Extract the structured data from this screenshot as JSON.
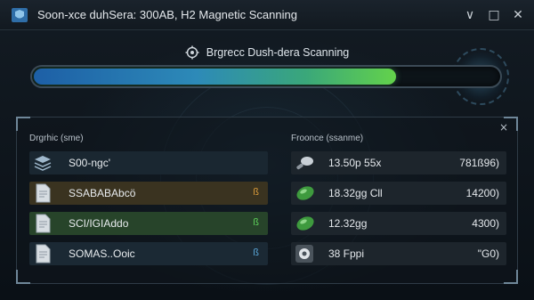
{
  "window": {
    "title": "Soon-xce duhSera: 300AB, H2 Magnetic Scanning",
    "minimize_glyph": "∨",
    "restore_glyph": "□",
    "close_glyph": "✕"
  },
  "scan": {
    "title": "Brgrecc Dush-dera Scanning",
    "progress_fraction": 0.78,
    "progress_colors": [
      "#1d5fa6",
      "#63d24b"
    ]
  },
  "results": {
    "close_glyph": "×",
    "left_header": "Drgrhic (sme)",
    "right_header": "Froonce (ssanme)",
    "left_rows": [
      {
        "name": "S00-ngc'",
        "badge": "",
        "icon": "stack-drive-icon",
        "bg": "#1a2731",
        "badge_color": "#c9d0d6"
      },
      {
        "name": "SSABABAbcö",
        "badge": "ß",
        "icon": "document-icon",
        "bg": "#3a3320",
        "badge_color": "#d89a3a"
      },
      {
        "name": "SCI/IGIAddo",
        "badge": "ß",
        "icon": "document-icon",
        "bg": "#27442a",
        "badge_color": "#5ed05a"
      },
      {
        "name": "SOMAS..Ooic",
        "badge": "ß",
        "icon": "document-icon",
        "bg": "#1b2934",
        "badge_color": "#5aa6d8"
      }
    ],
    "right_rows": [
      {
        "size": "13.50p 55x",
        "value": "781ß96)",
        "icon": "probe-icon",
        "bg": "#1d252c"
      },
      {
        "size": "18.32gg Cll",
        "value": "14200)",
        "icon": "green-pill-icon",
        "bg": "#1d252c"
      },
      {
        "size": "12.32gg",
        "value": "4300)",
        "icon": "green-pill-icon",
        "bg": "#1d252c"
      },
      {
        "size": "38 Fppi",
        "value": "\"G0)",
        "icon": "disk-icon",
        "bg": "#1d252c"
      }
    ]
  }
}
